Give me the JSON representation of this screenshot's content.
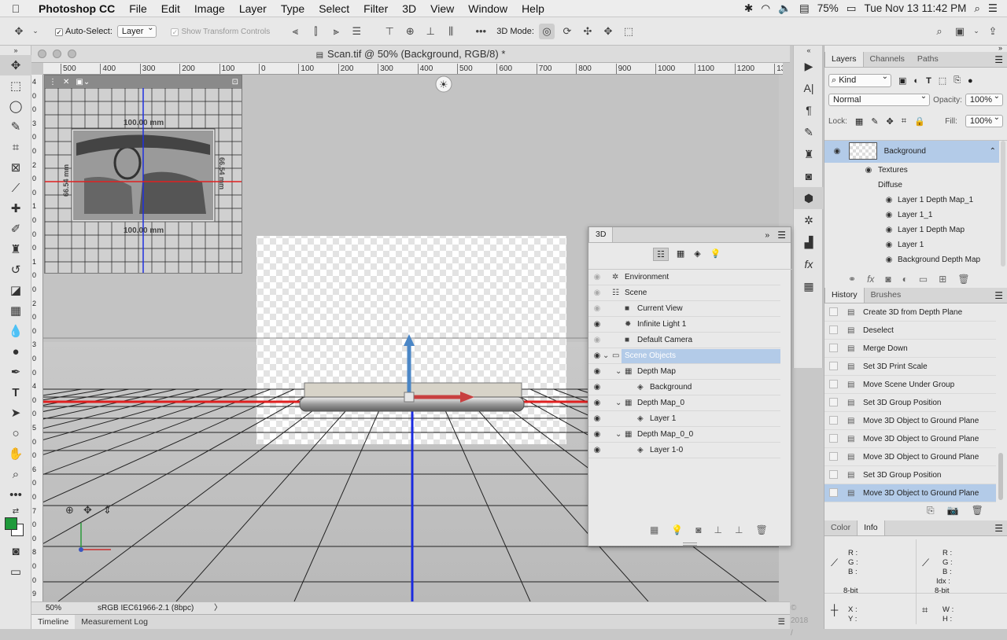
{
  "menubar": {
    "app_name": "Photoshop CC",
    "items": [
      "File",
      "Edit",
      "Image",
      "Layer",
      "Type",
      "Select",
      "Filter",
      "3D",
      "View",
      "Window",
      "Help"
    ],
    "battery": "75%",
    "clock": "Tue Nov 13  11:42 PM"
  },
  "options": {
    "auto_select_label": "Auto-Select:",
    "auto_select_value": "Layer",
    "show_transform_label": "Show Transform Controls",
    "mode_label": "3D Mode:"
  },
  "document": {
    "title": "Scan.tif @ 50% (Background, RGB/8) *",
    "zoom": "50%",
    "profile": "sRGB IEC61966-2.1 (8bpc)",
    "copyright": "© 2018 /"
  },
  "rulers": {
    "h_labels": [
      "500",
      "400",
      "300",
      "200",
      "100",
      "0",
      "100",
      "200",
      "300",
      "400",
      "500",
      "600",
      "700",
      "800",
      "900",
      "1000",
      "1100",
      "1200",
      "13"
    ],
    "v_labels": [
      "4",
      "0",
      "0",
      "3",
      "0",
      "0",
      "2",
      "0",
      "0",
      "1",
      "0",
      "0",
      "0",
      "1",
      "0",
      "0",
      "2",
      "0",
      "0",
      "3",
      "0",
      "0",
      "4",
      "0",
      "0",
      "5",
      "0",
      "0",
      "6",
      "0",
      "0",
      "7",
      "0",
      "0",
      "8",
      "0",
      "0",
      "9"
    ]
  },
  "navigator": {
    "dim_top": "100.00 mm",
    "dim_bottom": "100.00 mm",
    "dim_left": "66.54 mm",
    "dim_right": "66.54 mm"
  },
  "bottom_tabs": [
    "Timeline",
    "Measurement Log"
  ],
  "layers_panel": {
    "tabs": [
      "Layers",
      "Channels",
      "Paths"
    ],
    "kind": "Kind",
    "blend_mode": "Normal",
    "opacity_label": "Opacity:",
    "opacity": "100%",
    "lock_label": "Lock:",
    "fill_label": "Fill:",
    "fill": "100%",
    "layer_name": "Background",
    "textures_label": "Textures",
    "diffuse_label": "Diffuse",
    "textures": [
      "Layer 1 Depth Map_1",
      "Layer 1_1",
      "Layer 1 Depth Map",
      "Layer 1",
      "Background Depth Map"
    ]
  },
  "history_panel": {
    "tabs": [
      "History",
      "Brushes"
    ],
    "items": [
      "Create 3D from Depth Plane",
      "Deselect",
      "Merge Down",
      "Set 3D Print Scale",
      "Move Scene Under Group",
      "Set 3D Group Position",
      "Move 3D Object to Ground Plane",
      "Move 3D Object to Ground Plane",
      "Move 3D Object to Ground Plane",
      "Set 3D Group Position",
      "Move 3D Object to Ground Plane"
    ]
  },
  "info_panel": {
    "tabs": [
      "Color",
      "Info"
    ],
    "r": "R :",
    "g": "G :",
    "b": "B :",
    "idx": "Idx :",
    "bit_left": "8-bit",
    "bit_right": "8-bit",
    "x": "X :",
    "y": "Y :",
    "w": "W :",
    "h": "H :"
  },
  "panel_3d": {
    "title": "3D",
    "rows": [
      {
        "label": "Environment",
        "indent": 0,
        "icon": "✲"
      },
      {
        "label": "Scene",
        "indent": 0,
        "icon": "☷"
      },
      {
        "label": "Current View",
        "indent": 1,
        "icon": "■"
      },
      {
        "label": "Infinite Light 1",
        "indent": 1,
        "icon": "✹"
      },
      {
        "label": "Default Camera",
        "indent": 1,
        "icon": "■"
      },
      {
        "label": "Scene Objects",
        "indent": 0,
        "icon": "▭"
      },
      {
        "label": "Depth Map",
        "indent": 1,
        "icon": "▦"
      },
      {
        "label": "Background",
        "indent": 2,
        "icon": "◈"
      },
      {
        "label": "Depth Map_0",
        "indent": 1,
        "icon": "▦"
      },
      {
        "label": "Layer 1",
        "indent": 2,
        "icon": "◈"
      },
      {
        "label": "Depth Map_0_0",
        "indent": 1,
        "icon": "▦"
      },
      {
        "label": "Layer 1-0",
        "indent": 2,
        "icon": "◈"
      }
    ]
  }
}
